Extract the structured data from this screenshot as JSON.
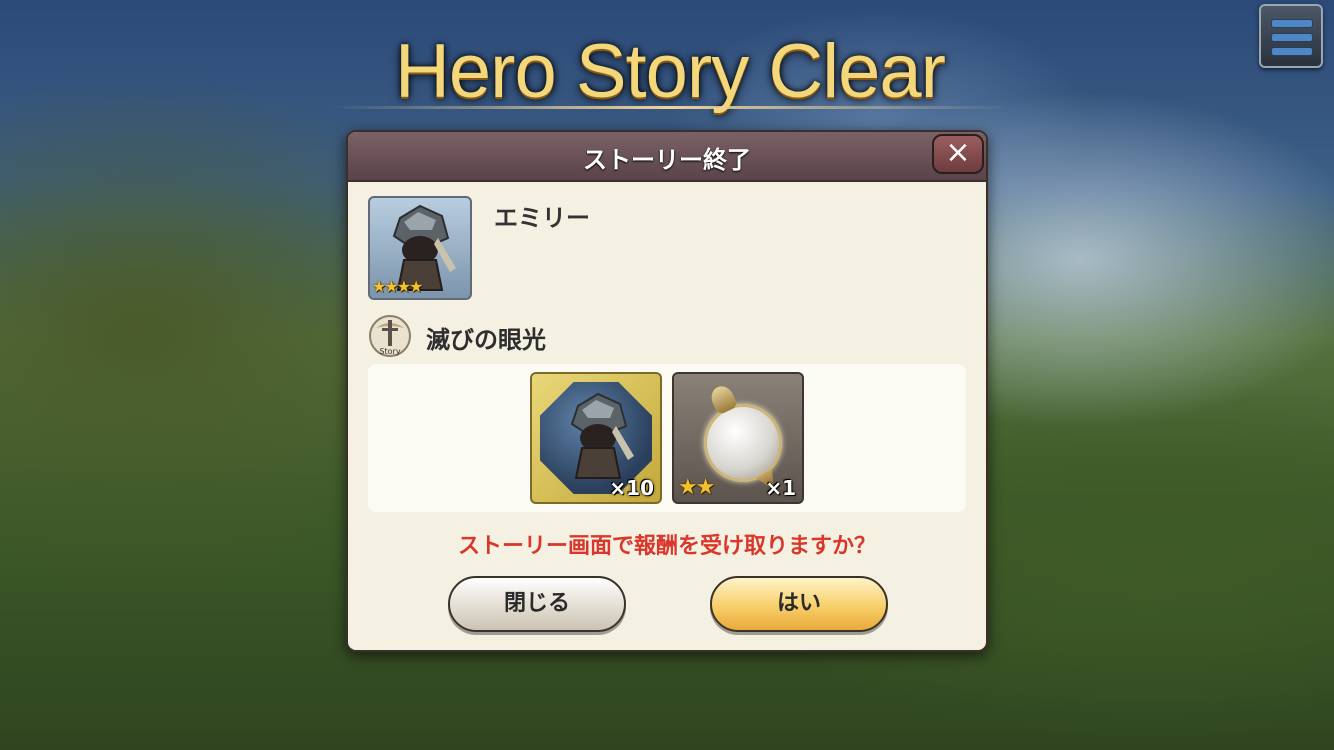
{
  "banner": {
    "title": "Hero Story Clear"
  },
  "menu": {
    "icon": "hamburger-menu-icon"
  },
  "dialog": {
    "title": "ストーリー終了",
    "close_icon": "close-x-icon",
    "hero": {
      "name": "エミリー",
      "rarity_stars": 4,
      "stars_text": "★★★★"
    },
    "story": {
      "icon": "story-sword-icon",
      "name": "滅びの眼光"
    },
    "rewards": [
      {
        "type": "hero-shard",
        "quantity": "×10"
      },
      {
        "type": "orb-item",
        "rarity_stars": 2,
        "stars_text": "★★",
        "quantity": "×1"
      }
    ],
    "question": "ストーリー画面で報酬を受け取りますか？",
    "buttons": {
      "close": "閉じる",
      "yes": "はい"
    }
  }
}
